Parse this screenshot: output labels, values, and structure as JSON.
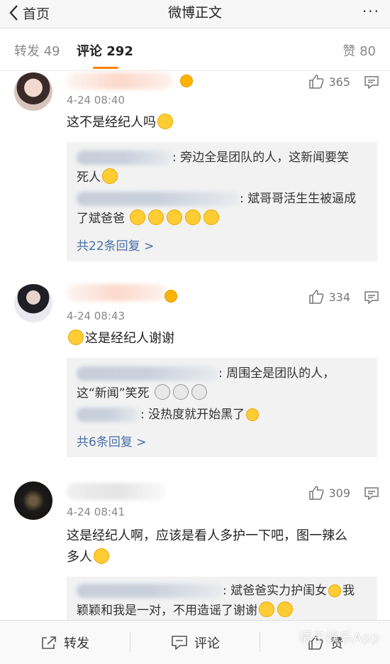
{
  "nav": {
    "back_label": "首页",
    "title": "微博正文",
    "more_label": "···"
  },
  "tabs": {
    "forward": "转发 49",
    "comments": "评论 292",
    "likes": "赞 80"
  },
  "comments": [
    {
      "likes": "365",
      "time": "4-24 08:40",
      "text": "这不是经纪人吗",
      "replies": [
        {
          "text": "旁边全是团队的人，这新闻要笑",
          "text2": "死人"
        },
        {
          "text": "斌哥哥活生生被逼成",
          "text2": "了斌爸爸"
        }
      ],
      "more_replies": "共22条回复 >"
    },
    {
      "likes": "334",
      "time": "4-24 08:43",
      "text": "这是经纪人谢谢",
      "replies": [
        {
          "text": "周围全是团队的人，",
          "text2": "这“新闻”笑死"
        },
        {
          "text": "没热度就开始黑了"
        }
      ],
      "more_replies": "共6条回复 >"
    },
    {
      "likes": "309",
      "time": "4-24 08:41",
      "text": "这是经纪人啊，应该是看人多护一下吧，图一辣么",
      "text2": "多人",
      "replies": [
        {
          "text": "斌爸爸实力护闺女",
          "text_end": "我",
          "text2": "颖颖和我是一对，不用造谣了谢谢"
        }
      ]
    }
  ],
  "bottom": {
    "forward": "转发",
    "comment": "评论",
    "like": "赞"
  },
  "watermark": "橘子娱乐App",
  "colors": {
    "accent": "#ff8200",
    "link": "#4a6ea8"
  }
}
